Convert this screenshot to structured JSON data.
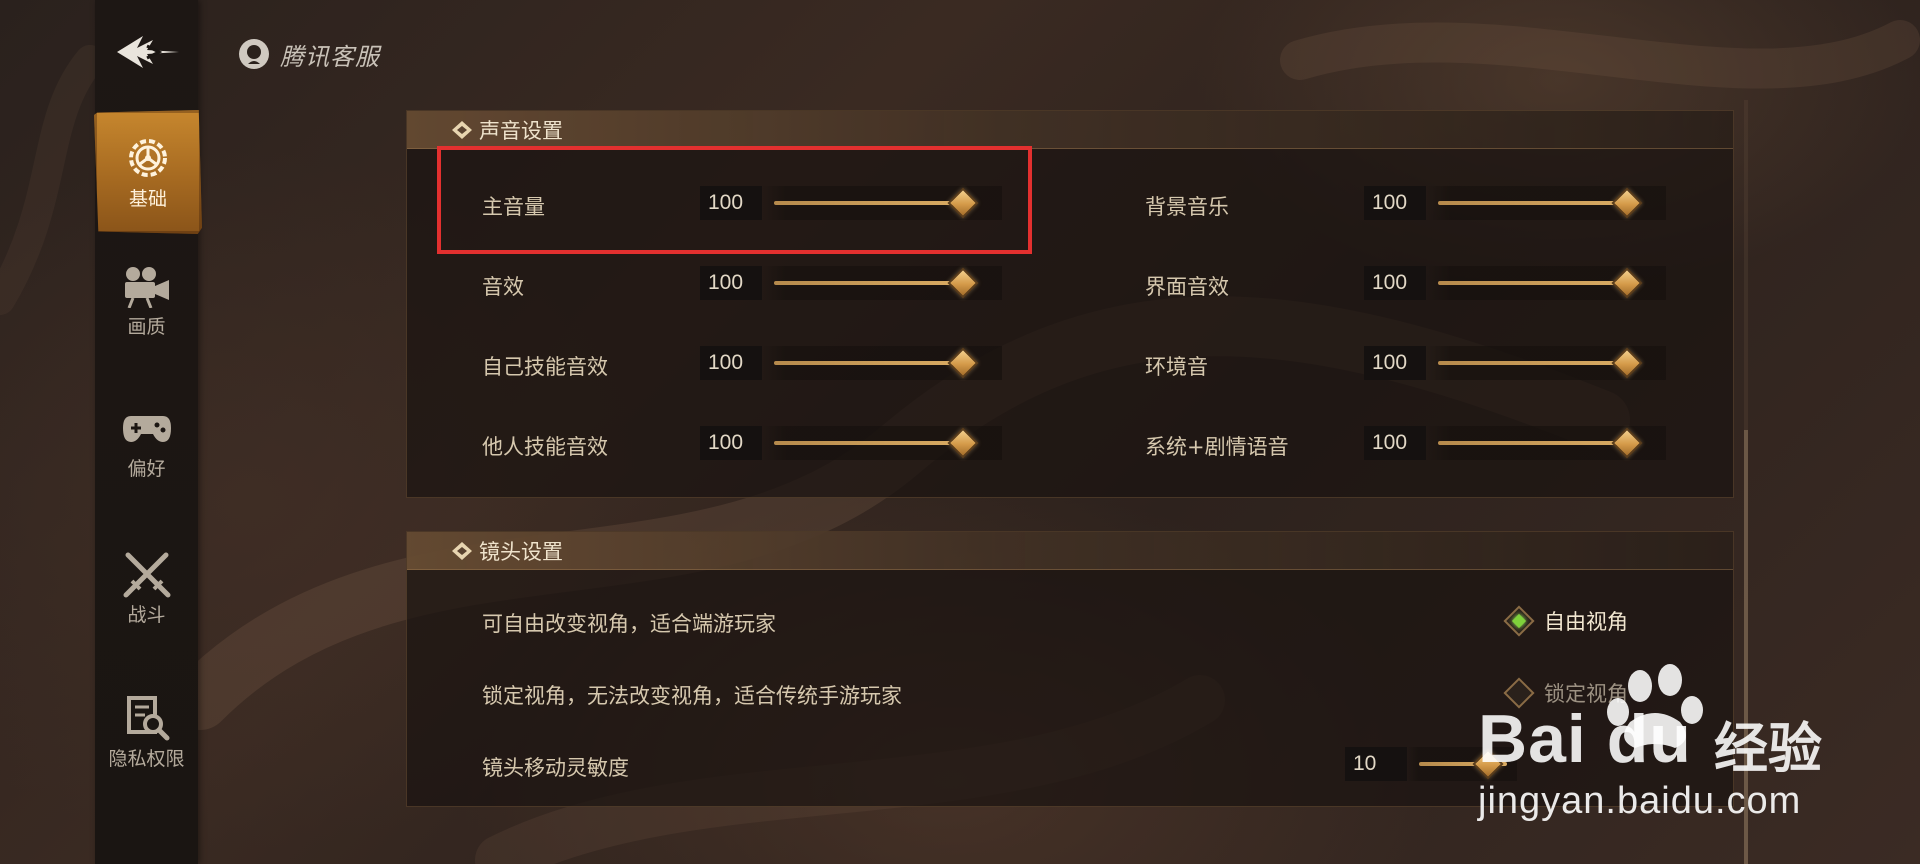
{
  "brand": {
    "name": "腾讯客服"
  },
  "nav": [
    {
      "label": "基础",
      "icon": "gear-icon",
      "active": true
    },
    {
      "label": "画质",
      "icon": "camera-icon",
      "active": false
    },
    {
      "label": "偏好",
      "icon": "gamepad-icon",
      "active": false
    },
    {
      "label": "战斗",
      "icon": "crossed-swords-icon",
      "active": false
    },
    {
      "label": "隐私权限",
      "icon": "privacy-search-icon",
      "active": false
    }
  ],
  "sound": {
    "title": "声音设置",
    "left": [
      {
        "label": "主音量",
        "value": "100",
        "fraction": 1.0
      },
      {
        "label": "音效",
        "value": "100",
        "fraction": 1.0
      },
      {
        "label": "自己技能音效",
        "value": "100",
        "fraction": 1.0
      },
      {
        "label": "他人技能音效",
        "value": "100",
        "fraction": 1.0
      }
    ],
    "right": [
      {
        "label": "背景音乐",
        "value": "100",
        "fraction": 1.0
      },
      {
        "label": "界面音效",
        "value": "100",
        "fraction": 1.0
      },
      {
        "label": "环境音",
        "value": "100",
        "fraction": 1.0
      },
      {
        "label": "系统+剧情语音",
        "value": "100",
        "fraction": 1.0
      }
    ]
  },
  "camera": {
    "title": "镜头设置",
    "free_desc": "可自由改变视角，适合端游玩家",
    "free_option": "自由视角",
    "free_selected": true,
    "lock_desc": "锁定视角，无法改变视角，适合传统手游玩家",
    "lock_option": "锁定视角",
    "lock_selected": false,
    "sensitivity_label": "镜头移动灵敏度",
    "sensitivity_value": "10"
  },
  "watermark": {
    "brand": "Bai du",
    "cn": "经验",
    "url": "jingyan.baidu.com"
  },
  "colors": {
    "accent": "#d49a49",
    "active_tab": "#b4762a",
    "highlight": "#e3302f",
    "selected": "#7fd23b"
  }
}
